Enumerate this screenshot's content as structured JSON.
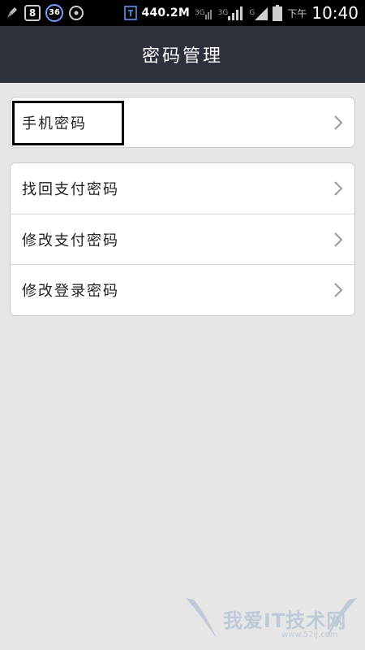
{
  "status_bar": {
    "notification_count": "8",
    "badge_36": "36",
    "net_speed": "440.2M",
    "signal_1_label": "3G",
    "signal_2_label": "3G",
    "signal_3_label": "G",
    "ampm": "下午",
    "time": "10:40"
  },
  "header": {
    "title": "密码管理"
  },
  "groups": [
    {
      "items": [
        {
          "label": "手机密码"
        }
      ]
    },
    {
      "items": [
        {
          "label": "找回支付密码"
        },
        {
          "label": "修改支付密码"
        },
        {
          "label": "修改登录密码"
        }
      ]
    }
  ],
  "watermark": {
    "text": "我爱IT技术网",
    "sub": "www.52ij.com"
  },
  "colors": {
    "header_bg": "#2c313c",
    "page_bg": "#e6e6e6",
    "status_bar_bg": "#000000"
  }
}
